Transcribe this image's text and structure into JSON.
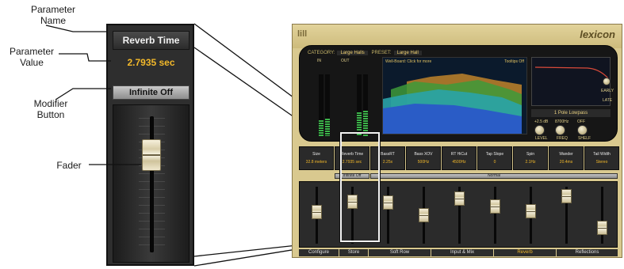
{
  "annotations": {
    "parameter_name": "Parameter\nName",
    "parameter_value": "Parameter\nValue",
    "modifier_button": "Modifier\nButton",
    "fader": "Fader"
  },
  "zoom_strip": {
    "name": "Reverb Time",
    "value": "2.7935 sec",
    "modifier": "Infinite Off",
    "fader_level": 0.22
  },
  "plugin": {
    "logo_left": "lill",
    "logo_right": "lexicon",
    "category_label": "CATEGORY:",
    "category_value": "Large Halls",
    "preset_label": "PRESET:",
    "preset_value": "Large Hall",
    "meters_in": "IN",
    "meters_out": "OUT",
    "graph_title": "Well-Board: Click for more",
    "graph_right": "Tooltips Off",
    "eq_mode": "1 Pole Lowpass",
    "knobs": [
      {
        "label": "LEVEL",
        "value": "+2.5 dB"
      },
      {
        "label": "FREQ",
        "value": "8700Hz"
      },
      {
        "label": "SHELF",
        "value": "OFF"
      }
    ],
    "early_label": "EARLY",
    "late_label": "LATE",
    "parameters": [
      {
        "name": "Size",
        "value": "32.8 meters"
      },
      {
        "name": "Reverb Time",
        "value": "2.7935 sec"
      },
      {
        "name": "BassRT",
        "value": "2.25x"
      },
      {
        "name": "Bass XOV",
        "value": "500Hz"
      },
      {
        "name": "RT HiCut",
        "value": "4500Hz"
      },
      {
        "name": "Tap Slope",
        "value": "0"
      },
      {
        "name": "Spin",
        "value": "2.1Hz"
      },
      {
        "name": "Wander",
        "value": "20.4ms"
      },
      {
        "name": "Tail Width",
        "value": "Stereo"
      }
    ],
    "modifier_small": "Infinite Off",
    "modifier_normal": "Normal",
    "fader_levels": [
      0.42,
      0.18,
      0.2,
      0.5,
      0.12,
      0.3,
      0.4,
      0.05,
      0.8
    ],
    "tabs": [
      {
        "label": "Configure",
        "active": false
      },
      {
        "label": "Store",
        "active": false
      },
      {
        "label": "Soft Row",
        "active": false
      },
      {
        "label": "Input & Mix",
        "active": false
      },
      {
        "label": "Reverb",
        "active": true
      },
      {
        "label": "Reflections",
        "active": false
      }
    ]
  }
}
